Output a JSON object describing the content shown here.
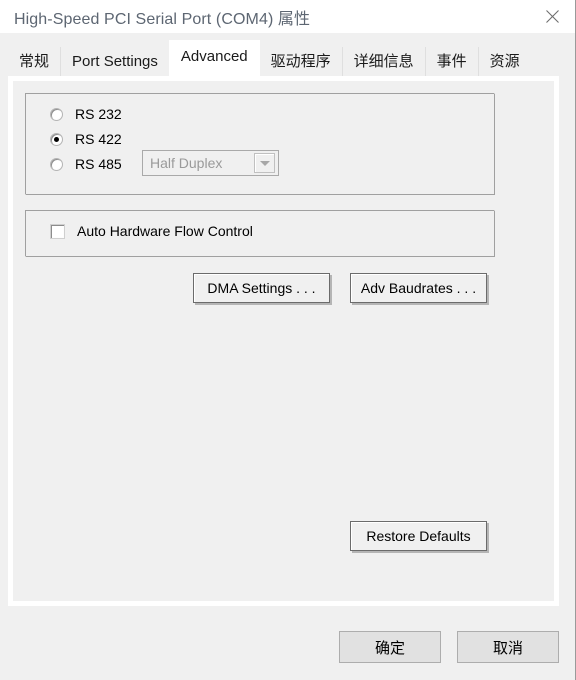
{
  "window": {
    "title": "High-Speed PCI Serial Port (COM4) 属性",
    "close_icon": "close-icon"
  },
  "tabs": [
    {
      "label": "常规",
      "active": false
    },
    {
      "label": "Port Settings",
      "active": false
    },
    {
      "label": "Advanced",
      "active": true
    },
    {
      "label": "驱动程序",
      "active": false
    },
    {
      "label": "详细信息",
      "active": false
    },
    {
      "label": "事件",
      "active": false
    },
    {
      "label": "资源",
      "active": false
    }
  ],
  "advanced": {
    "mode_group": {
      "options": [
        {
          "label": "RS 232",
          "selected": false
        },
        {
          "label": "RS 422",
          "selected": true
        },
        {
          "label": "RS 485",
          "selected": false
        }
      ],
      "duplex_combo": {
        "value": "Half Duplex",
        "enabled": false,
        "arrow_icon": "chevron-down-icon"
      }
    },
    "flow_group": {
      "checkbox": {
        "label": "Auto Hardware Flow Control",
        "checked": false
      }
    },
    "buttons": {
      "dma_settings": "DMA Settings . . .",
      "adv_baudrates": "Adv Baudrates . . .",
      "restore_defaults": "Restore Defaults"
    }
  },
  "footer": {
    "ok": "确定",
    "cancel": "取消"
  },
  "colors": {
    "title_text": "#5d6672",
    "dialog_bg": "#f0f0f0",
    "panel_bg": "#ffffff",
    "disabled_text": "#9a9a9a",
    "button_border": "#6b6b6b",
    "footer_button_bg": "#e1e1e1"
  }
}
